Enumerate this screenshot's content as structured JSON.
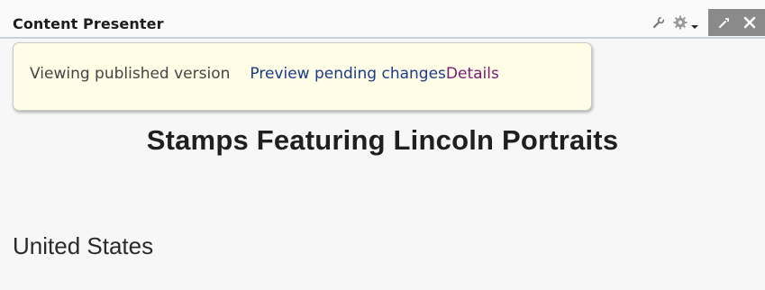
{
  "header": {
    "title": "Content Presenter",
    "icons": [
      "wrench-icon",
      "gear-icon",
      "chevron-down-icon",
      "edit-icon",
      "close-icon"
    ]
  },
  "version_bar": {
    "status": "Viewing published version",
    "preview_link": "Preview pending changes",
    "details_link": "Details"
  },
  "content": {
    "heading": "Stamps Featuring Lincoln Portraits",
    "subheading": "United States"
  },
  "colors": {
    "header_border": "#c9d3e0",
    "version_bar_bg": "#fffde6",
    "preview_link": "#1a3b8c",
    "details_link": "#7a1a74",
    "edit_panel_bg": "#8a8a8a"
  }
}
